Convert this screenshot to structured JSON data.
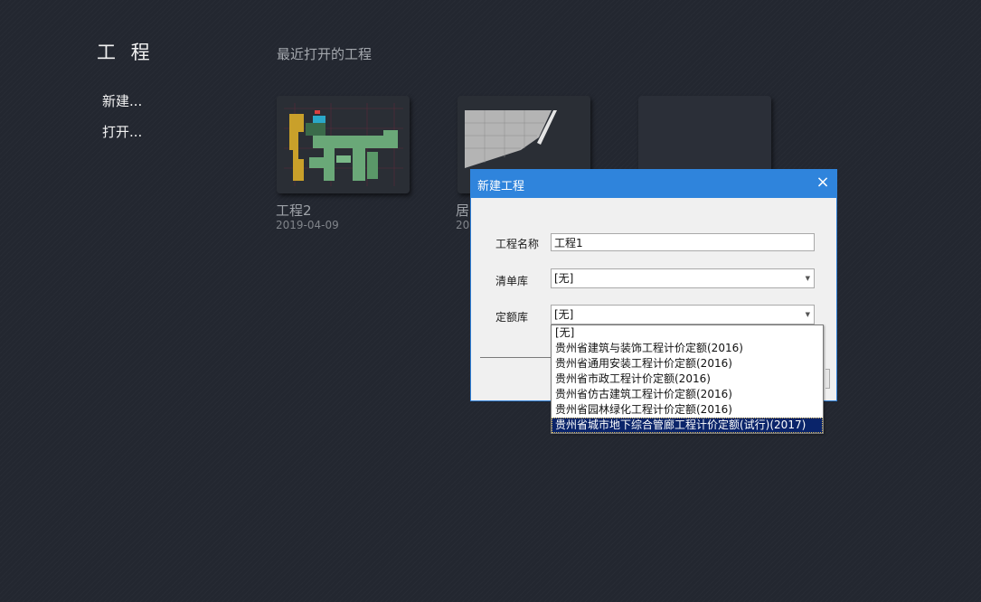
{
  "sidebar": {
    "title": "工 程",
    "items": [
      {
        "label": "新建..."
      },
      {
        "label": "打开..."
      }
    ]
  },
  "recent": {
    "title": "最近打开的工程",
    "projects": [
      {
        "name": "工程2",
        "date": "2019-04-09"
      },
      {
        "name": "居",
        "date": "20"
      },
      {
        "name": "",
        "date": ""
      }
    ]
  },
  "dialog": {
    "title": "新建工程",
    "close_icon": "×",
    "fields": {
      "name_label": "工程名称",
      "name_value": "工程1",
      "list_label": "清单库",
      "list_value": "[无]",
      "quota_label": "定额库",
      "quota_value": "[无]"
    }
  },
  "dropdown": {
    "options": [
      "[无]",
      "贵州省建筑与装饰工程计价定额(2016)",
      "贵州省通用安装工程计价定额(2016)",
      "贵州省市政工程计价定额(2016)",
      "贵州省仿古建筑工程计价定额(2016)",
      "贵州省园林绿化工程计价定额(2016)",
      "贵州省城市地下综合管廊工程计价定额(试行)(2017)"
    ],
    "selected_index": 6
  }
}
